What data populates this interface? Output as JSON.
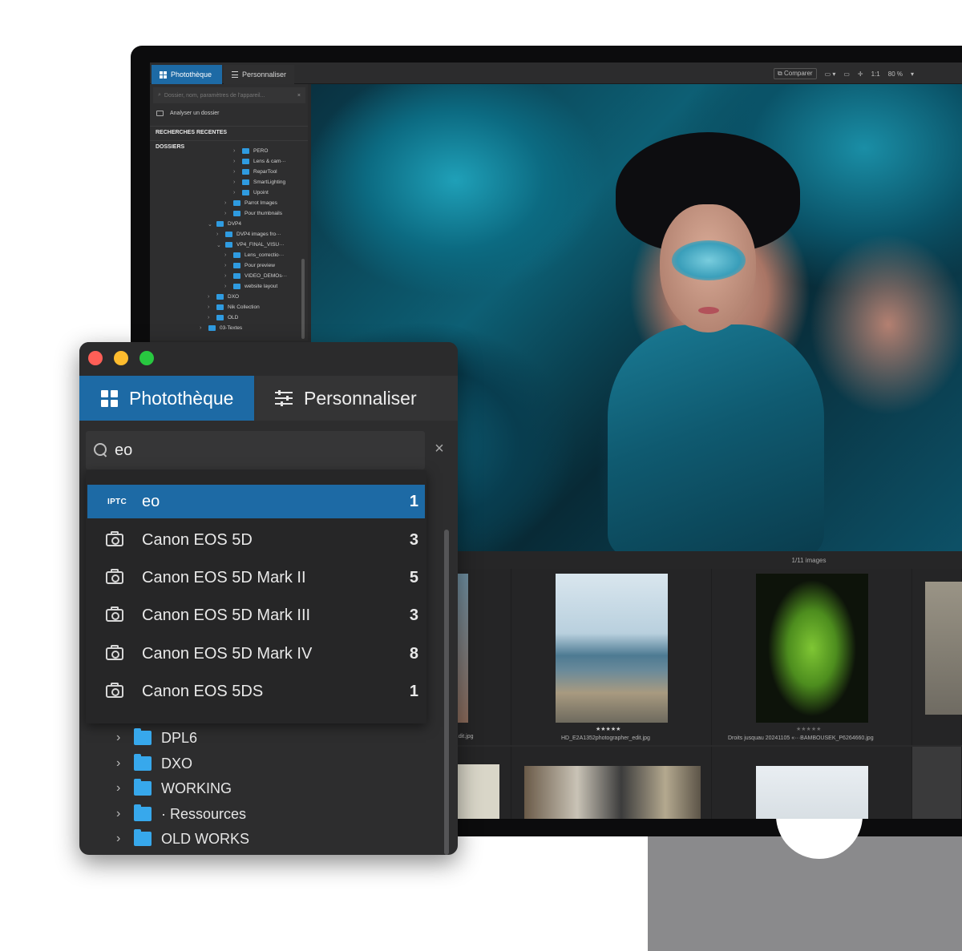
{
  "screen": {
    "tabs": [
      {
        "label": "Photothèque",
        "icon": "grid-icon",
        "active": true
      },
      {
        "label": "Personnaliser",
        "icon": "sliders-icon",
        "active": false
      }
    ],
    "toolbar": {
      "compare_label": "Comparer",
      "ratio_label": "1:1",
      "zoom_value": "80 %"
    },
    "search_placeholder": "Dossier, nom, paramètres de l'appareil...",
    "analyse_label": "Analyser un dossier",
    "recent_header": "RECHERCHES RECENTES",
    "folders_header": "DOSSIERS",
    "tree": [
      "PERO",
      "Lens & cam···",
      "ReparTool",
      "SmartLighting",
      "Upoint",
      "Parrot Images",
      "Pour thumbnails",
      "DVP4",
      "DVP4 images fro···",
      "VP4_FINAL_VISU···",
      "Lens_correctio···",
      "Pour preview",
      "VIDEO_DEMOs···",
      "website layout",
      "DXO",
      "Nik Collection",
      "OLD",
      "03-Textes"
    ],
    "image_count": "1/11 images",
    "thumbs": [
      {
        "name": "...dit.jpg",
        "stars": ""
      },
      {
        "name": "HD_E2A1352photographer_edit.jpg",
        "stars": "★★★★★"
      },
      {
        "name": "Droits jusquau 20241105 «···BAMBOUSEK_P6264660.jpg",
        "stars": "★★★★★"
      }
    ]
  },
  "window": {
    "tabs": [
      {
        "label": "Photothèque",
        "icon": "grid-icon",
        "active": true
      },
      {
        "label": "Personnaliser",
        "icon": "sliders-icon",
        "active": false
      }
    ],
    "search_value": "eo",
    "suggestions": [
      {
        "tag": "IPTC",
        "icon": "",
        "label": "eo",
        "count": "1",
        "selected": true
      },
      {
        "tag": "",
        "icon": "camera-icon",
        "label": "Canon EOS 5D",
        "count": "3",
        "selected": false
      },
      {
        "tag": "",
        "icon": "camera-icon",
        "label": "Canon EOS 5D Mark II",
        "count": "5",
        "selected": false
      },
      {
        "tag": "",
        "icon": "camera-icon",
        "label": "Canon EOS 5D Mark III",
        "count": "3",
        "selected": false
      },
      {
        "tag": "",
        "icon": "camera-icon",
        "label": "Canon EOS 5D Mark IV",
        "count": "8",
        "selected": false
      },
      {
        "tag": "",
        "icon": "camera-icon",
        "label": "Canon EOS 5DS",
        "count": "1",
        "selected": false
      }
    ],
    "folders": [
      "DPL6",
      "DXO",
      "WORKING",
      "· Ressources",
      "OLD WORKS"
    ]
  },
  "colors": {
    "accent": "#1d6aa5",
    "folder": "#37a8ec",
    "close": "#ff5f57",
    "minimize": "#febc2e",
    "zoom": "#28c840"
  }
}
